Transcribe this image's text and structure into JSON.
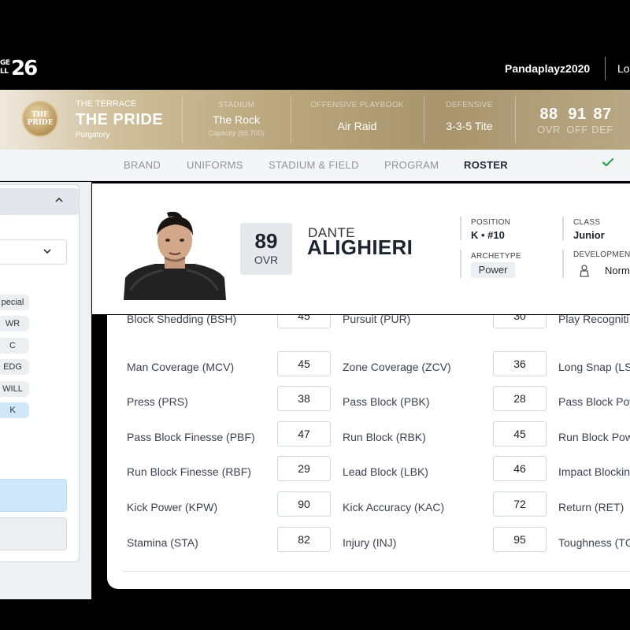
{
  "header": {
    "logo_small": "GE\nLL",
    "logo_big": "26",
    "username": "Pandaplayz2020",
    "logout": "Lo"
  },
  "team": {
    "badge_line1": "THE",
    "badge_line2": "PRIDE",
    "super": "THE TERRACE",
    "name": "THE PRIDE",
    "conference": "Purgatory",
    "stadium_label": "STADIUM",
    "stadium": "The Rock",
    "capacity": "Capacity (66,700)",
    "offense_label": "OFFENSIVE PLAYBOOK",
    "offense": "Air Raid",
    "defense_label": "DEFENSIVE",
    "defense": "3-3-5 Tite",
    "ratings": [
      {
        "value": "88",
        "label": "OVR"
      },
      {
        "value": "91",
        "label": "OFF"
      },
      {
        "value": "87",
        "label": "DEF"
      }
    ]
  },
  "subnav": {
    "tabs": [
      "BRAND",
      "UNIFORMS",
      "STADIUM & FIELD",
      "PROGRAM",
      "ROSTER"
    ],
    "active": "ROSTER",
    "check_icon": "check-icon"
  },
  "filters": {
    "positions": [
      "pecial",
      "WR",
      "C",
      "EDG",
      "WILL",
      "K"
    ],
    "active_position": "K"
  },
  "player": {
    "ovr": "89",
    "ovr_label": "OVR",
    "first_name": "DANTE",
    "last_name": "ALIGHIERI",
    "position_label": "POSITION",
    "position": "K • #10",
    "class_label": "CLASS",
    "class": "Junior",
    "archetype_label": "ARCHETYPE",
    "archetype": "Power",
    "development_label": "DEVELOPMENT",
    "development": "Norm"
  },
  "ratings_rows": [
    [
      {
        "name": "Block Shedding (BSH)",
        "value": "45"
      },
      {
        "name": "Pursuit (PUR)",
        "value": "30"
      },
      {
        "name": "Play Recogniti"
      }
    ],
    [
      {
        "name": "Man Coverage (MCV)",
        "value": "45"
      },
      {
        "name": "Zone Coverage (ZCV)",
        "value": "36"
      },
      {
        "name": "Long Snap (LS"
      }
    ],
    [
      {
        "name": "Press (PRS)",
        "value": "38"
      },
      {
        "name": "Pass Block (PBK)",
        "value": "28"
      },
      {
        "name": "Pass Block Pow"
      }
    ],
    [
      {
        "name": "Pass Block Finesse (PBF)",
        "value": "47"
      },
      {
        "name": "Run Block (RBK)",
        "value": "45"
      },
      {
        "name": "Run Block Pow"
      }
    ],
    [
      {
        "name": "Run Block Finesse (RBF)",
        "value": "29"
      },
      {
        "name": "Lead Block (LBK)",
        "value": "46"
      },
      {
        "name": "Impact Blockin"
      }
    ],
    [
      {
        "name": "Kick Power (KPW)",
        "value": "90"
      },
      {
        "name": "Kick Accuracy (KAC)",
        "value": "72"
      },
      {
        "name": "Return (RET)"
      }
    ],
    [
      {
        "name": "Stamina (STA)",
        "value": "82"
      },
      {
        "name": "Injury (INJ)",
        "value": "95"
      },
      {
        "name": "Toughness (TG"
      }
    ]
  ]
}
